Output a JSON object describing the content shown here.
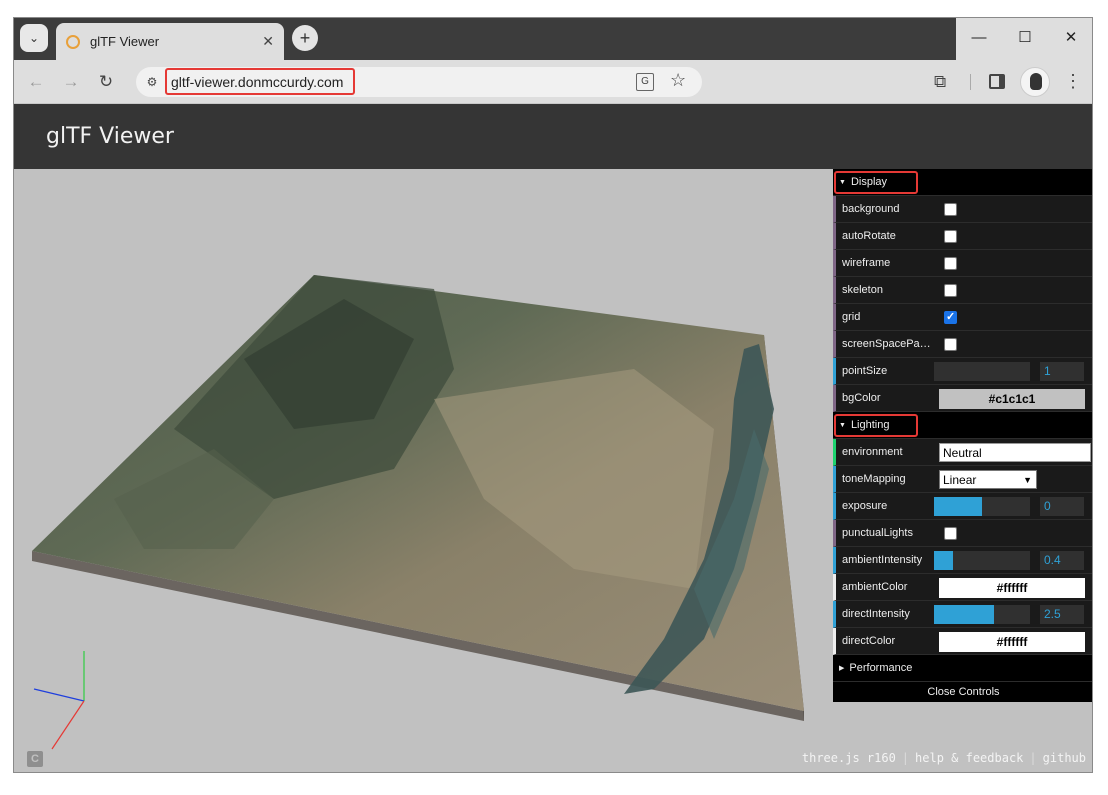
{
  "browser": {
    "tab_title": "glTF Viewer",
    "url": "gltf-viewer.donmccurdy.com",
    "tab_search_icon": "chevron-down-icon",
    "new_tab_symbol": "+",
    "back_symbol": "←",
    "forward_symbol": "→",
    "reload_symbol": "↻",
    "window_min_symbol": "—",
    "window_max_symbol": "☐",
    "window_close_symbol": "✕",
    "tab_close_symbol": "✕",
    "star_symbol": "☆",
    "menu_symbol": "⋮",
    "extension_symbol": "⧉",
    "translate_symbol": "G",
    "site_info_symbol": "⚙"
  },
  "app": {
    "title": "glTF Viewer"
  },
  "viewport": {
    "corner_logo": "C",
    "footer": [
      {
        "label": "three.js r160"
      },
      {
        "label": "help & feedback"
      },
      {
        "label": "github"
      }
    ],
    "background_color": "#c1c1c1"
  },
  "gui": {
    "display": {
      "title": "Display",
      "background": {
        "label": "background",
        "checked": false
      },
      "autoRotate": {
        "label": "autoRotate",
        "checked": false
      },
      "wireframe": {
        "label": "wireframe",
        "checked": false
      },
      "skeleton": {
        "label": "skeleton",
        "checked": false
      },
      "grid": {
        "label": "grid",
        "checked": true
      },
      "screenSpacePanning": {
        "label": "screenSpacePan…",
        "checked": false
      },
      "pointSize": {
        "label": "pointSize",
        "value": "1",
        "fraction": 0
      },
      "bgColor": {
        "label": "bgColor",
        "value": "#c1c1c1",
        "color": "#c1c1c1"
      }
    },
    "lighting": {
      "title": "Lighting",
      "environment": {
        "label": "environment",
        "value": "Neutral"
      },
      "toneMapping": {
        "label": "toneMapping",
        "value": "Linear"
      },
      "exposure": {
        "label": "exposure",
        "value": "0",
        "fraction": 0.5
      },
      "punctualLights": {
        "label": "punctualLights",
        "checked": false
      },
      "ambientIntensity": {
        "label": "ambientIntensity",
        "value": "0.4",
        "fraction": 0.2
      },
      "ambientColor": {
        "label": "ambientColor",
        "value": "#ffffff",
        "color": "#ffffff"
      },
      "directIntensity": {
        "label": "directIntensity",
        "value": "2.5",
        "fraction": 0.63
      },
      "directColor": {
        "label": "directColor",
        "value": "#ffffff",
        "color": "#ffffff"
      }
    },
    "performance": {
      "title": "Performance"
    },
    "close_label": "Close Controls"
  }
}
